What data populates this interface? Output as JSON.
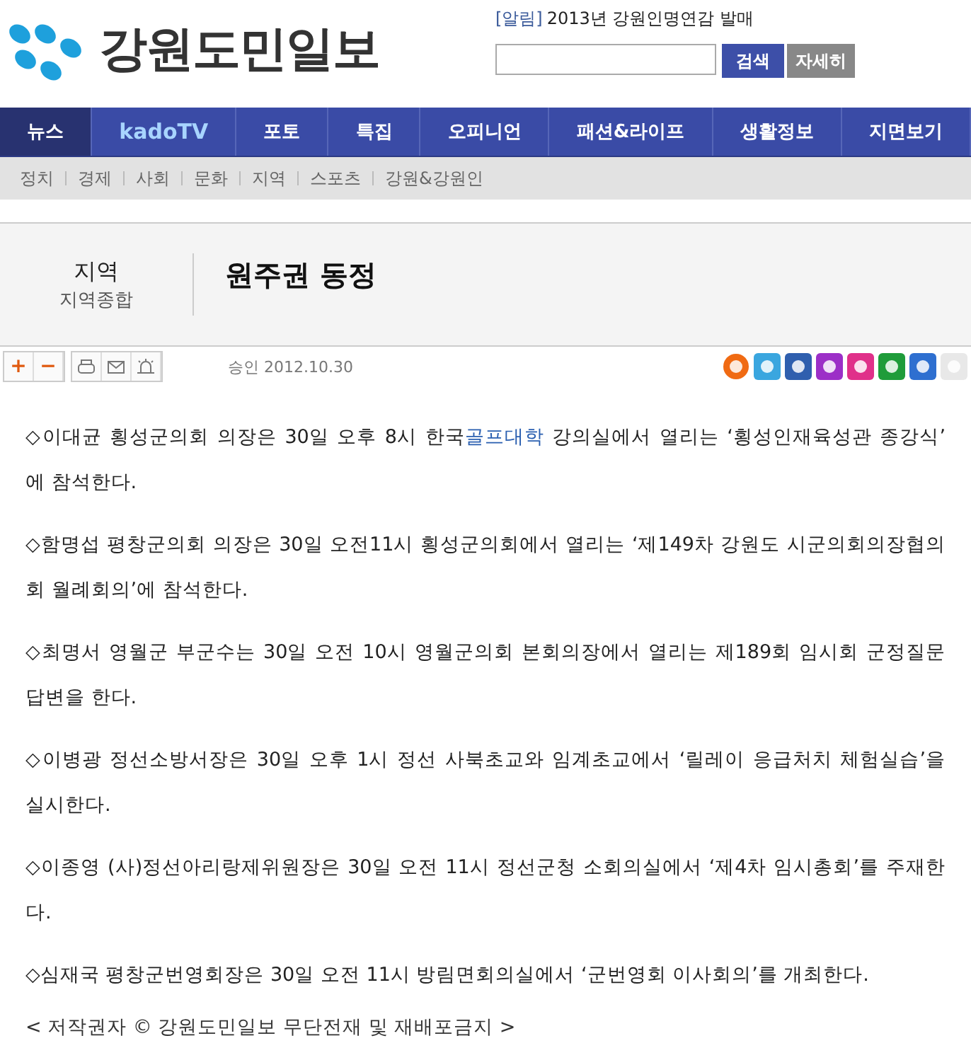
{
  "logo": {
    "name": "강원도민일보"
  },
  "notice": {
    "tag": "[알림]",
    "text": "2013년 강원인명연감 발매"
  },
  "search": {
    "button": "검색",
    "detail_button": "자세히"
  },
  "nav": [
    {
      "label": "뉴스",
      "selected": true,
      "kind": "text"
    },
    {
      "label": "kadoTV",
      "selected": false,
      "kind": "logo"
    },
    {
      "label": "포토",
      "selected": false,
      "kind": "text"
    },
    {
      "label": "특집",
      "selected": false,
      "kind": "text"
    },
    {
      "label": "오피니언",
      "selected": false,
      "kind": "text"
    },
    {
      "label": "패션&라이프",
      "selected": false,
      "kind": "text"
    },
    {
      "label": "생활정보",
      "selected": false,
      "kind": "text"
    },
    {
      "label": "지면보기",
      "selected": false,
      "kind": "text"
    }
  ],
  "subnav": [
    "정치",
    "경제",
    "사회",
    "문화",
    "지역",
    "스포츠",
    "강원&강원인"
  ],
  "article_header": {
    "section": "지역",
    "subsection": "지역종합",
    "title": "원주권 동정"
  },
  "toolbar": {
    "zoom_in": "+",
    "zoom_out": "−",
    "approved": "승인 2012.10.30"
  },
  "share_buttons": [
    {
      "color": "#f06a12"
    },
    {
      "color": "#3aa6df"
    },
    {
      "color": "#2f5fae"
    },
    {
      "color": "#9c2fc7"
    },
    {
      "color": "#e0308a"
    },
    {
      "color": "#1f9c3a"
    },
    {
      "color": "#2e6fd0"
    },
    {
      "color": "#e8e8e8"
    }
  ],
  "paragraphs": [
    {
      "parts": [
        {
          "kind": "text",
          "text": "◇이대균 횡성군의회 의장은 30일 오후 8시 한국"
        },
        {
          "kind": "link",
          "text": "골프대학"
        },
        {
          "kind": "text",
          "text": " 강의실에서 열리는 ‘횡성인재육성관 종강식’ 에 참석한다."
        }
      ]
    },
    {
      "parts": [
        {
          "kind": "text",
          "text": "◇함명섭 평창군의회 의장은 30일 오전11시 횡성군의회에서 열리는 ‘제149차 강원도 시군의회의장협의회 월례회의’에 참석한다."
        }
      ]
    },
    {
      "parts": [
        {
          "kind": "text",
          "text": "◇최명서 영월군 부군수는 30일 오전 10시 영월군의회 본회의장에서 열리는 제189회 임시회 군정질문 답변을 한다."
        }
      ]
    },
    {
      "parts": [
        {
          "kind": "text",
          "text": "◇이병광 정선소방서장은 30일 오후 1시 정선 사북초교와 임계초교에서 ‘릴레이 응급처치 체험실습’을 실시한다."
        }
      ]
    },
    {
      "parts": [
        {
          "kind": "text",
          "text": "◇이종영 (사)정선아리랑제위원장은 30일 오전 11시 정선군청 소회의실에서 ‘제4차 임시총회’를 주재한다."
        }
      ]
    },
    {
      "parts": [
        {
          "kind": "text",
          "text": "◇심재국 평창군번영회장은 30일 오전 11시 방림면회의실에서 ‘군번영회 이사회의’를 개최한다."
        }
      ]
    }
  ],
  "copyright": "< 저작권자 © 강원도민일보 무단전재 및 재배포금지 >"
}
